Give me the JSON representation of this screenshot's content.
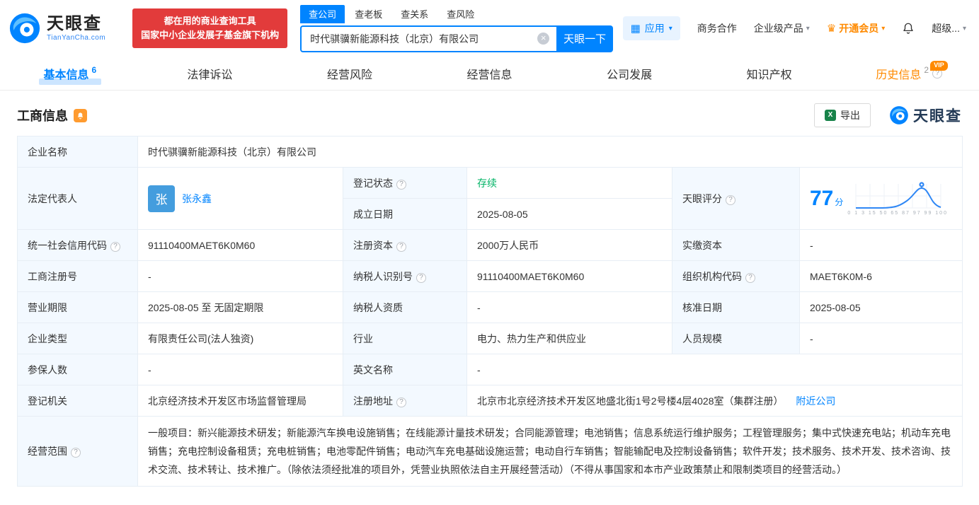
{
  "colors": {
    "brand_blue": "#0084ff",
    "promo_red": "#e23b3b",
    "vip_orange": "#ff8a00",
    "status_green": "#00b365",
    "link_blue": "#0084ff"
  },
  "icons": {
    "help": "?",
    "caret": "▾",
    "clear": "×",
    "grid": "▦",
    "crown": "♛",
    "excel": "X"
  },
  "header": {
    "logo_cn": "天眼查",
    "logo_en": "TianYanCha.com",
    "promo_line1": "都在用的商业查询工具",
    "promo_line2": "国家中小企业发展子基金旗下机构",
    "search_tabs": [
      "查公司",
      "查老板",
      "查关系",
      "查风险"
    ],
    "search_value": "时代骐骥新能源科技（北京）有限公司",
    "search_button": "天眼一下",
    "menu_app": "应用",
    "menu_cooperation": "商务合作",
    "menu_enterprise": "企业级产品",
    "menu_vip": "开通会员",
    "menu_super": "超级..."
  },
  "nav_tabs": [
    {
      "label": "基本信息",
      "count": "6"
    },
    {
      "label": "法律诉讼"
    },
    {
      "label": "经营风险"
    },
    {
      "label": "经营信息"
    },
    {
      "label": "公司发展"
    },
    {
      "label": "知识产权"
    },
    {
      "label": "历史信息",
      "count": "2",
      "badge": "VIP"
    }
  ],
  "section": {
    "title": "工商信息",
    "export_label": "导出",
    "brand": "天眼查"
  },
  "legal_rep": {
    "avatar_text": "张"
  },
  "links": {
    "nearby": "附近公司"
  },
  "score": {
    "value": "77",
    "unit": "分",
    "axis": "0 1 3 15 50 65 87 97 99 100"
  },
  "fields": [
    {
      "label": "企业名称",
      "value": "时代骐骥新能源科技（北京）有限公司"
    },
    {
      "label": "法定代表人",
      "value": "张永鑫"
    },
    {
      "label": "登记状态",
      "value": "存续"
    },
    {
      "label": "成立日期",
      "value": "2025-08-05"
    },
    {
      "label": "天眼评分",
      "value": "77分"
    },
    {
      "label": "统一社会信用代码",
      "value": "91110400MAET6K0M60"
    },
    {
      "label": "注册资本",
      "value": "2000万人民币"
    },
    {
      "label": "实缴资本",
      "value": "-"
    },
    {
      "label": "工商注册号",
      "value": "-"
    },
    {
      "label": "纳税人识别号",
      "value": "91110400MAET6K0M60"
    },
    {
      "label": "组织机构代码",
      "value": "MAET6K0M-6"
    },
    {
      "label": "营业期限",
      "value": "2025-08-05 至 无固定期限"
    },
    {
      "label": "纳税人资质",
      "value": "-"
    },
    {
      "label": "核准日期",
      "value": "2025-08-05"
    },
    {
      "label": "企业类型",
      "value": "有限责任公司(法人独资)"
    },
    {
      "label": "行业",
      "value": "电力、热力生产和供应业"
    },
    {
      "label": "人员规模",
      "value": "-"
    },
    {
      "label": "参保人数",
      "value": "-"
    },
    {
      "label": "英文名称",
      "value": "-"
    },
    {
      "label": "登记机关",
      "value": "北京经济技术开发区市场监督管理局"
    },
    {
      "label": "注册地址",
      "value": "北京市北京经济技术开发区地盛北街1号2号楼4层4028室（集群注册）"
    },
    {
      "label": "经营范围",
      "value": "一般项目：新兴能源技术研发；新能源汽车换电设施销售；在线能源计量技术研发；合同能源管理；电池销售；信息系统运行维护服务；工程管理服务；集中式快速充电站；机动车充电销售；充电控制设备租赁；充电桩销售；电池零配件销售；电动汽车充电基础设施运营；电动自行车销售；智能输配电及控制设备销售；软件开发；技术服务、技术开发、技术咨询、技术交流、技术转让、技术推广。（除依法须经批准的项目外，凭营业执照依法自主开展经营活动）（不得从事国家和本市产业政策禁止和限制类项目的经营活动。）"
    }
  ]
}
